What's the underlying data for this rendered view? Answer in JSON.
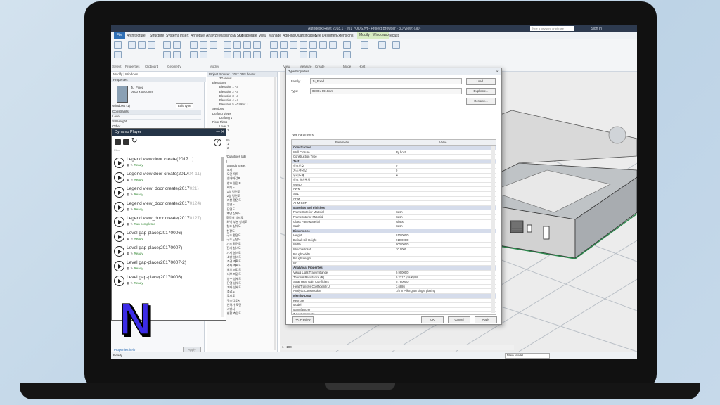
{
  "title_bar": {
    "title": "Autodesk Revit 2018.1 - 201 7ODS.rvt - Project Browser - 3D View: {3D}",
    "search_placeholder": "Type a keyword or phrase",
    "sign_in": "Sign In"
  },
  "ribbon_tabs": [
    "File",
    "Architecture",
    "Structure",
    "Systems",
    "Insert",
    "Annotate",
    "Analyze",
    "Massing & Site",
    "Collaborate",
    "View",
    "Manage",
    "Add-Ins",
    "Quantification",
    "Site Designer",
    "Extensions",
    "Modify | Windows",
    "Precast"
  ],
  "ribbon_groups": [
    "Select",
    "Properties",
    "Clipboard",
    "Geometry",
    "Modify",
    "View",
    "Measure",
    "Create",
    "Mode",
    "Host"
  ],
  "context_label": "Modify | Windows",
  "properties": {
    "header": "Properties",
    "type_name": "Ju_Fixed",
    "type_size": "0900 x 0910mm",
    "filter": "Windows (1)",
    "edit_type": "Edit Type",
    "rows": [
      "Constraints",
      "Level",
      "Sill Height",
      "Other",
      "Head Height"
    ],
    "help_link": "Properties help",
    "apply": "Apply"
  },
  "project_browser": {
    "header": "Project Browser - 2017 ODS dev.rvt",
    "items": [
      "3D Views",
      "Elevations",
      "Elevation 1 - a",
      "Elevation 2 - a",
      "Elevation 3 - a",
      "Elevation 4 - a",
      "Elevation 5 - Callout 1",
      "Sections",
      "Drafting Views",
      "Drafting 1",
      "Floor Plans",
      "Level 1",
      "Level 2",
      "Site",
      "Ceiling Plans",
      "Level 1",
      "Level 2",
      "Legends",
      "Schedules/Quantities (all)",
      "Sheets (all)",
      "000 - Sangdo Sheet",
      "001 - 표지",
      "101 - 도면 목록",
      "102 - 실내마감표",
      "103 - 창호 일람표",
      "104 - 배치도",
      "105 - 1층 평면도",
      "106 - 2층 평면도",
      "107 - 지붕 평면도",
      "108 - 입면도",
      "109 - 단면도",
      "110 - 계단 상세도",
      "111 - 화장실 상세도",
      "112 - 외벽 부분 상세도",
      "113 - 창호 상세도",
      "114 - 천장도",
      "115 - 구조 평면도",
      "116 - 구조 단면도",
      "117 - 기초 평면도",
      "118 - 전기 설비도",
      "119 - 기계 설비도",
      "120 - 소방 설비도",
      "121 - 조경 계획도",
      "122 - 주차 계획도",
      "123 - 외부 마감도",
      "124 - 내부 마감도",
      "125 - 방수 상세도",
      "126 - 단열 상세도",
      "127 - 기타 상세도",
      "128 - 조감도",
      "129 - 투시도",
      "130 - 구조검토서",
      "131 - 인허가 도면",
      "132 - 시방서",
      "133 - 현황 측량도"
    ]
  },
  "dynamo": {
    "title": "Dynamo Player",
    "filter_placeholder": "Filter",
    "scripts": [
      {
        "name": "Legend view door create(2017",
        "num": "...)",
        "status": "Ready",
        "status_color": "#3a8c3a"
      },
      {
        "name": "Legend view door create(2017",
        "num": "04-11)",
        "status": "Ready",
        "status_color": "#3a8c3a"
      },
      {
        "name": "Legend view_door create(2017",
        "num": "021)",
        "status": "Ready",
        "status_color": "#3a8c3a"
      },
      {
        "name": "Legend view_door create(2017",
        "num": "0124)",
        "status": "Ready",
        "status_color": "#3a8c3a"
      },
      {
        "name": "Legend view_door create(2017",
        "num": "0127)",
        "status": "Run completed",
        "status_color": "#3a8c3a"
      },
      {
        "name": "Level gap-place(20170006)",
        "num": "",
        "status": "Ready",
        "status_color": "#3a8c3a"
      },
      {
        "name": "Level gap-place(20170007)",
        "num": "",
        "status": "Ready",
        "status_color": "#3a8c3a"
      },
      {
        "name": "Level gap-place(20170007-2)",
        "num": "",
        "status": "Ready",
        "status_color": "#3a8c3a"
      },
      {
        "name": "Level gap-place(20170006)",
        "num": "",
        "status": "Ready",
        "status_color": "#3a8c3a"
      }
    ]
  },
  "type_properties": {
    "title": "Type Properties",
    "family_label": "Family:",
    "family_value": "Ju_Fixed",
    "type_label": "Type:",
    "type_value": "0900 x 0910mm",
    "load_button": "Load...",
    "duplicate_button": "Duplicate...",
    "rename_button": "Rename...",
    "type_parameters_label": "Type Parameters",
    "col_parameter": "Parameter",
    "col_value": "Value",
    "rows": [
      {
        "p": "Construction",
        "v": "",
        "group": true
      },
      {
        "p": "Wall Closure",
        "v": "By host"
      },
      {
        "p": "Construction Type",
        "v": ""
      },
      {
        "p": "Text",
        "v": "",
        "group": true
      },
      {
        "p": "창호번호",
        "v": "0"
      },
      {
        "p": "가스켓유무",
        "v": "0"
      },
      {
        "p": "유리두께",
        "v": "■",
        "check": true
      },
      {
        "p": "창호 설치위치",
        "v": ""
      },
      {
        "p": "WD40",
        "v": ""
      },
      {
        "p": "AWM",
        "v": ""
      },
      {
        "p": "SSL",
        "v": ""
      },
      {
        "p": "AHM",
        "v": ""
      },
      {
        "p": "AHM GST",
        "v": ""
      },
      {
        "p": "Materials and Finishes",
        "v": "",
        "group": true
      },
      {
        "p": "Frame Exterior Material",
        "v": "Sash"
      },
      {
        "p": "Frame Interior Material",
        "v": "Sash"
      },
      {
        "p": "Glass Pane Material",
        "v": "Glass"
      },
      {
        "p": "Sash",
        "v": "Sash"
      },
      {
        "p": "Dimensions",
        "v": "",
        "group": true
      },
      {
        "p": "Height",
        "v": "910.0000"
      },
      {
        "p": "Default Sill Height",
        "v": "910.0000"
      },
      {
        "p": "Width",
        "v": "900.0000"
      },
      {
        "p": "Window Inset",
        "v": "30.0000"
      },
      {
        "p": "Rough Width",
        "v": ""
      },
      {
        "p": "Rough Height",
        "v": ""
      },
      {
        "p": "W1",
        "v": ""
      },
      {
        "p": "Analytical Properties",
        "v": "",
        "group": true
      },
      {
        "p": "Visual Light Transmittance",
        "v": "0.900000"
      },
      {
        "p": "Thermal Resistance (R)",
        "v": "0.2217 (m²·K)/W"
      },
      {
        "p": "Solar Heat Gain Coefficient",
        "v": "0.780000"
      },
      {
        "p": "Heat Transfer Coefficient (U)",
        "v": "3.6886"
      },
      {
        "p": "Analytic Construction",
        "v": "1/8 in Pilkington single glazing"
      },
      {
        "p": "Identity Data",
        "v": "",
        "group": true
      },
      {
        "p": "Keynote",
        "v": ""
      },
      {
        "p": "Model",
        "v": ""
      },
      {
        "p": "Manufacturer",
        "v": ""
      },
      {
        "p": "Type Comments",
        "v": ""
      }
    ],
    "preview_button": "<< Preview",
    "ok_button": "OK",
    "cancel_button": "Cancel",
    "apply_button": "Apply"
  },
  "view_control": {
    "scale": "1 : 100"
  },
  "status": {
    "text": "Ready",
    "selection": "Main Model"
  },
  "logo_letter": "N",
  "colors": {
    "logo_fill": "#3b2be6",
    "title_bar": "#2d3a4f",
    "group_row": "#d5dceb"
  }
}
